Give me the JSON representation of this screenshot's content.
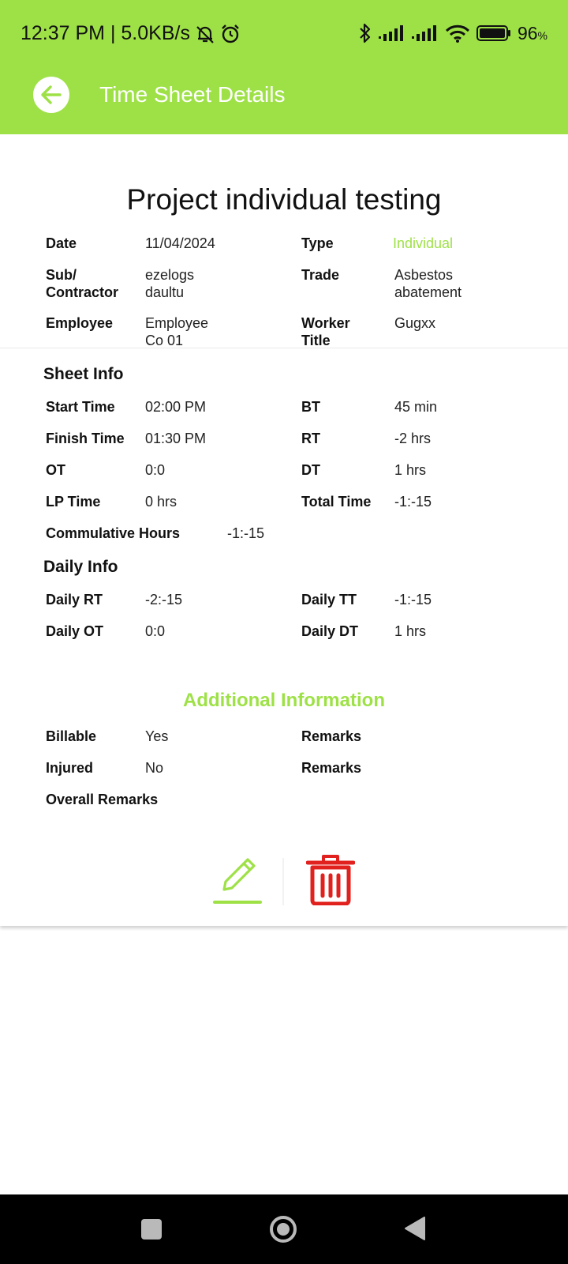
{
  "status_bar": {
    "time_speed": "12:37 PM | 5.0KB/s",
    "battery": "96",
    "battery_unit": "%",
    "icons": [
      "mute-bell-icon",
      "alarm-icon",
      "bluetooth-icon",
      "signal-icon",
      "signal-icon",
      "wifi-icon",
      "battery-icon"
    ]
  },
  "appbar": {
    "title": "Time Sheet Details",
    "back_icon": "arrow-left-icon"
  },
  "project": {
    "title": "Project individual testing"
  },
  "details": {
    "date_label": "Date",
    "date_value": "11/04/2024",
    "type_label": "Type",
    "type_value": "Individual",
    "sub_label_1": "Sub/",
    "sub_label_2": "Contractor",
    "sub_value_1": "ezelogs",
    "sub_value_2": "daultu",
    "trade_label": "Trade",
    "trade_value_1": "Asbestos",
    "trade_value_2": "abatement",
    "employee_label": "Employee",
    "employee_value_1": "Employee",
    "employee_value_2": "Co 01",
    "worker_title_label_1": "Worker",
    "worker_title_label_2": "Title",
    "worker_title_value": "Gugxx"
  },
  "sheet_info": {
    "heading": "Sheet Info",
    "start_time_label": "Start Time",
    "start_time_value": "02:00 PM",
    "bt_label": "BT",
    "bt_value": "45 min",
    "finish_time_label": "Finish Time",
    "finish_time_value": "01:30 PM",
    "rt_label": "RT",
    "rt_value": "-2 hrs",
    "ot_label": "OT",
    "ot_value": "0:0",
    "dt_label": "DT",
    "dt_value": "1 hrs",
    "lp_time_label": "LP Time",
    "lp_time_value": "0 hrs",
    "total_time_label": "Total Time",
    "total_time_value": "-1:-15",
    "cumulative_label": "Commulative Hours",
    "cumulative_value": "-1:-15"
  },
  "daily_info": {
    "heading": "Daily Info",
    "daily_rt_label": "Daily RT",
    "daily_rt_value": "-2:-15",
    "daily_tt_label": "Daily TT",
    "daily_tt_value": "-1:-15",
    "daily_ot_label": "Daily OT",
    "daily_ot_value": "0:0",
    "daily_dt_label": "Daily DT",
    "daily_dt_value": "1 hrs"
  },
  "additional": {
    "heading": "Additional Information",
    "billable_label": "Billable",
    "billable_value": "Yes",
    "remarks_label_1": "Remarks",
    "injured_label": "Injured",
    "injured_value": "No",
    "remarks_label_2": "Remarks",
    "overall_remarks_label": "Overall Remarks"
  },
  "actions": {
    "edit_icon": "pencil-icon",
    "delete_icon": "trash-icon"
  },
  "colors": {
    "accent": "#9ee147",
    "danger": "#e0211d",
    "nav_bg": "#000000"
  },
  "navigation": {
    "icons": [
      "recent-apps-icon",
      "home-icon",
      "back-icon"
    ]
  }
}
